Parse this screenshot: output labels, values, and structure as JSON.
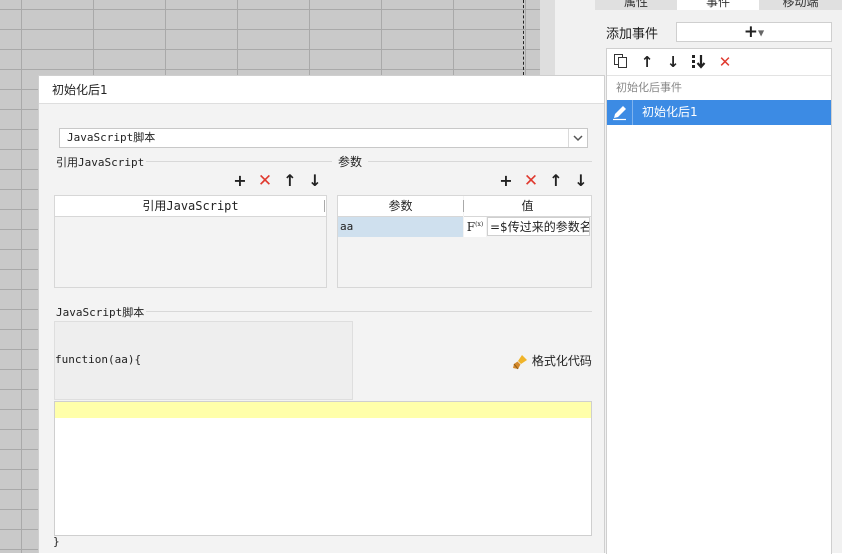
{
  "right_panel": {
    "tabs": [
      "属性",
      "事件",
      "移动端"
    ],
    "add_event_label": "添加事件",
    "add_event_button": "+",
    "group_label": "初始化后事件",
    "event_item_label": "初始化后1"
  },
  "dialog": {
    "title": "初始化后1",
    "type_select_value": "JavaScript脚本",
    "ref_section_title": "引用JavaScript",
    "ref_column_header": "引用JavaScript",
    "param_section_title": "参数",
    "param_columns": [
      "参数",
      "值"
    ],
    "param_rows": [
      {
        "name": "aa",
        "formula_label": "F",
        "formula_sup": "(x)",
        "value": "=$传过来的参数名"
      }
    ],
    "script_section_title": "JavaScript脚本",
    "function_header": "function(aa){",
    "format_button_label": "格式化代码",
    "function_footer": "}"
  },
  "colors": {
    "selection_blue": "#3c8be4",
    "delete_red": "#e03a2f",
    "editor_highlight": "#ffffaa"
  }
}
